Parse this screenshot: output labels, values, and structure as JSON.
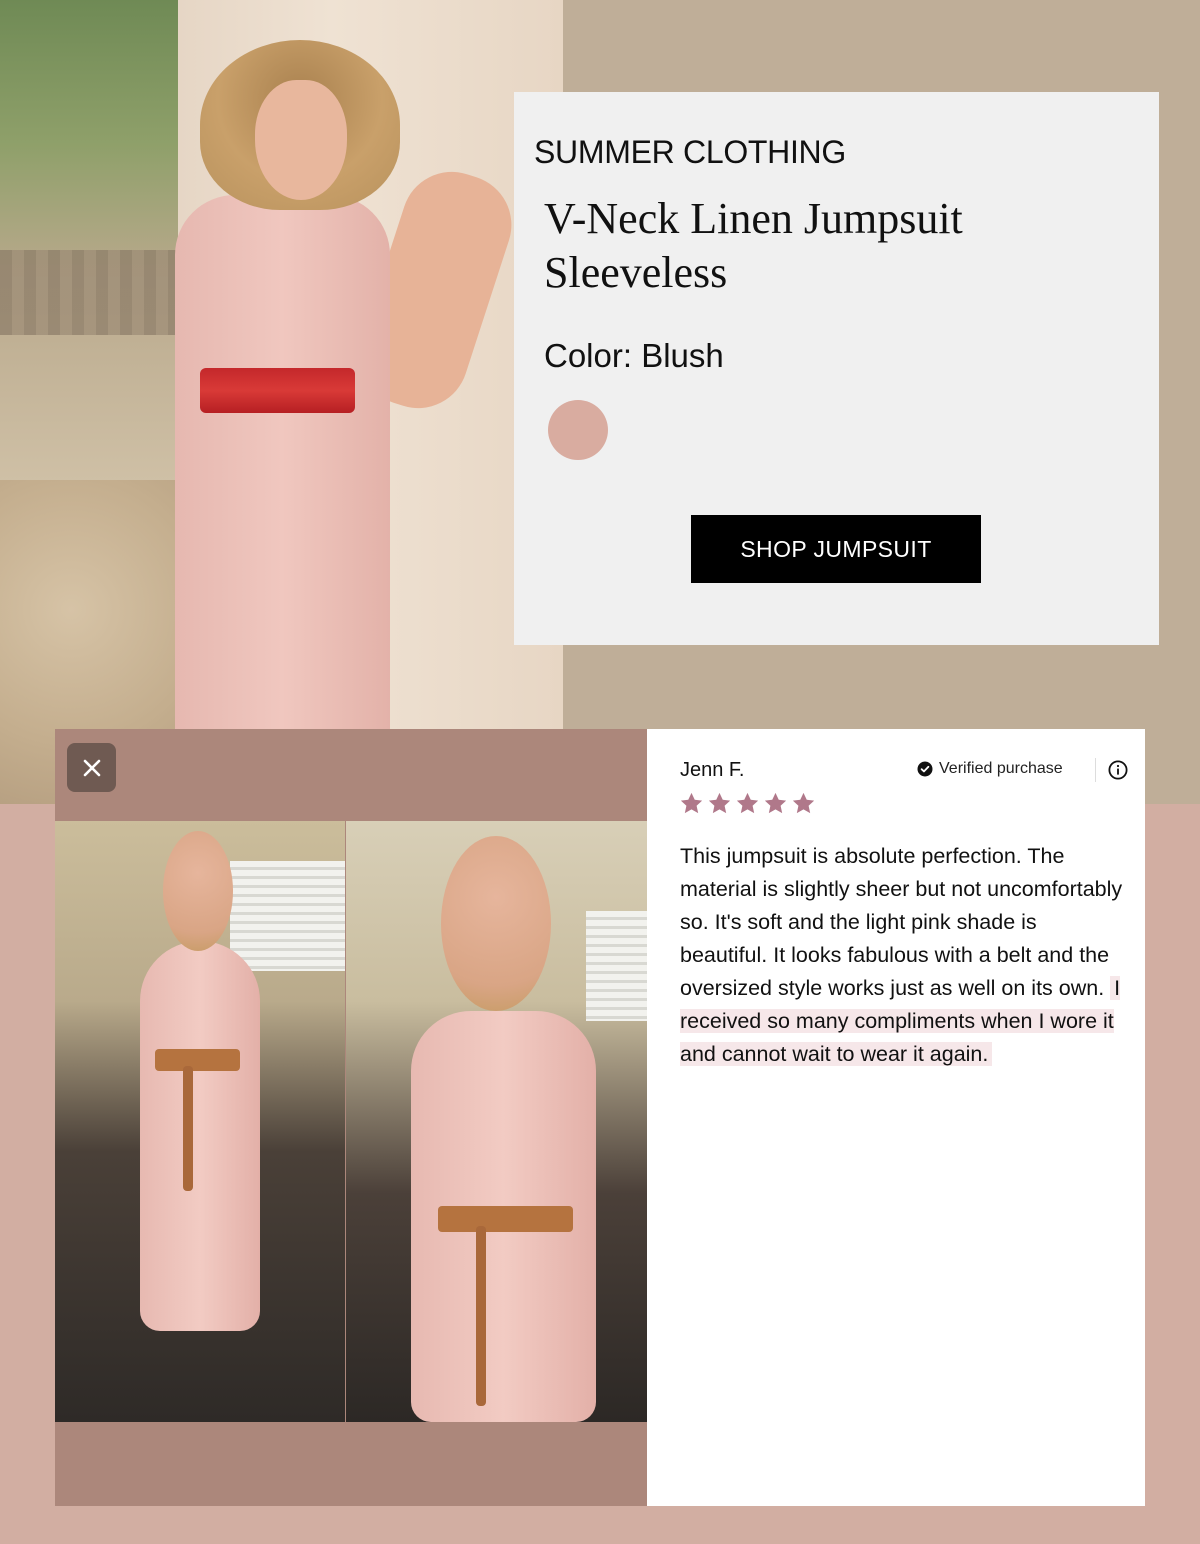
{
  "product": {
    "category": "SUMMER CLOTHING",
    "title": "V-Neck Linen Jumpsuit Sleeveless",
    "color_label": "Color: Blush",
    "swatch_color": "#d9aca0",
    "shop_button": "SHOP JUMPSUIT"
  },
  "review": {
    "reviewer": "Jenn F.",
    "verified": "Verified purchase",
    "rating": 5,
    "star_color": "#b0788a",
    "text_plain": "This jumpsuit is absolute perfection. The material is slightly sheer but not uncomfortably so. It's soft and the light pink shade is beautiful. It looks fabulous with a belt and the oversized style works just as well on its own.",
    "text_highlight": "I received so many compliments when I wore it and cannot wait to wear it again."
  },
  "icons": {
    "close": "close-icon",
    "verified": "check-circle-icon",
    "info": "info-icon",
    "star": "star-icon"
  },
  "colors": {
    "page_bg": "#bfae98",
    "bottom_band": "#d2aea2",
    "media_bg": "#ac877b",
    "button_bg": "#000000",
    "highlight_bg": "#f6e7e9"
  }
}
